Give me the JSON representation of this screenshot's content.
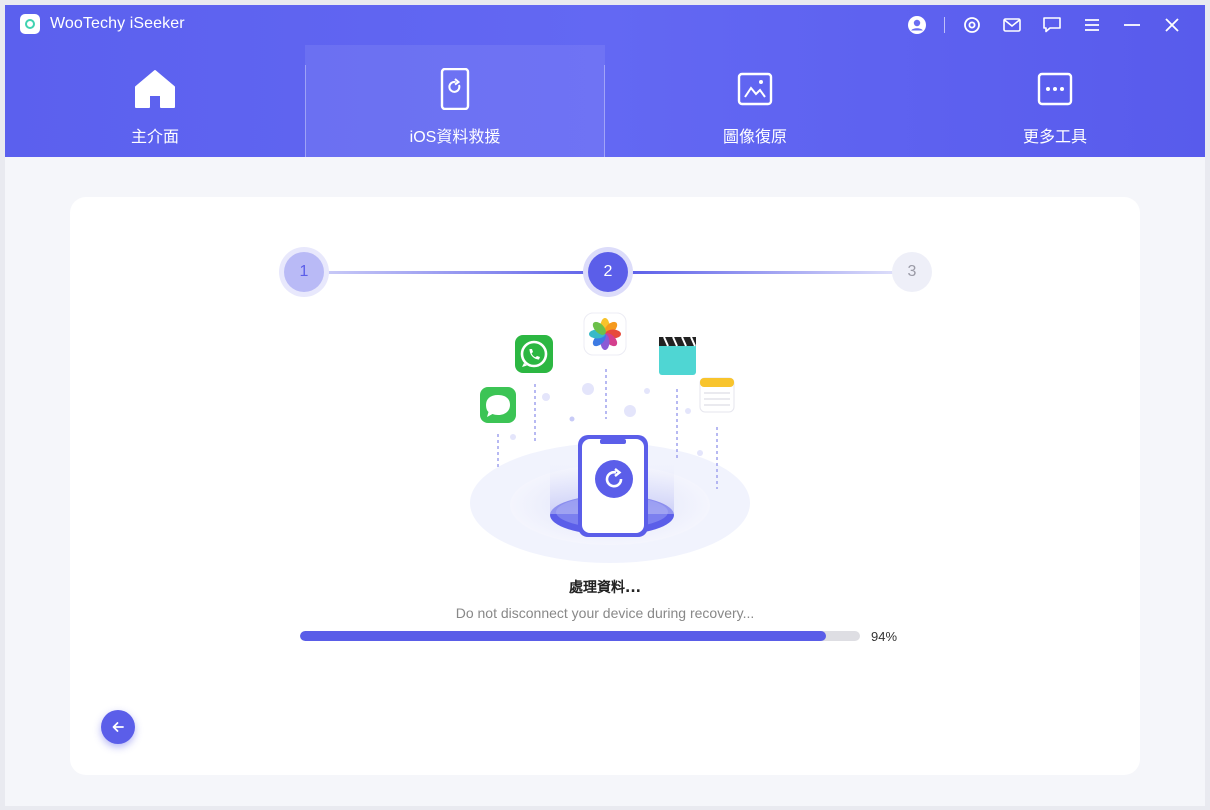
{
  "app": {
    "title": "WooTechy iSeeker"
  },
  "titlebar": {
    "icons": [
      "account-icon",
      "settings-icon",
      "mail-icon",
      "feedback-icon",
      "menu-icon",
      "minimize-icon",
      "close-icon"
    ]
  },
  "nav": {
    "items": [
      {
        "label": "主介面",
        "icon": "home-icon",
        "active": false
      },
      {
        "label": "iOS資料救援",
        "icon": "ios-recovery-icon",
        "active": true
      },
      {
        "label": "圖像復原",
        "icon": "image-repair-icon",
        "active": false
      },
      {
        "label": "更多工具",
        "icon": "more-tools-icon",
        "active": false
      }
    ]
  },
  "steps": [
    {
      "number": "1",
      "state": "done"
    },
    {
      "number": "2",
      "state": "current"
    },
    {
      "number": "3",
      "state": "pending"
    }
  ],
  "status": {
    "title": "處理資料...",
    "subtitle": "Do not disconnect your device during recovery...",
    "progress_value": 0.94,
    "progress_label": "94%"
  },
  "colors": {
    "accent": "#5b5ee9",
    "header": "#5f64f1",
    "track": "#dedee3"
  }
}
